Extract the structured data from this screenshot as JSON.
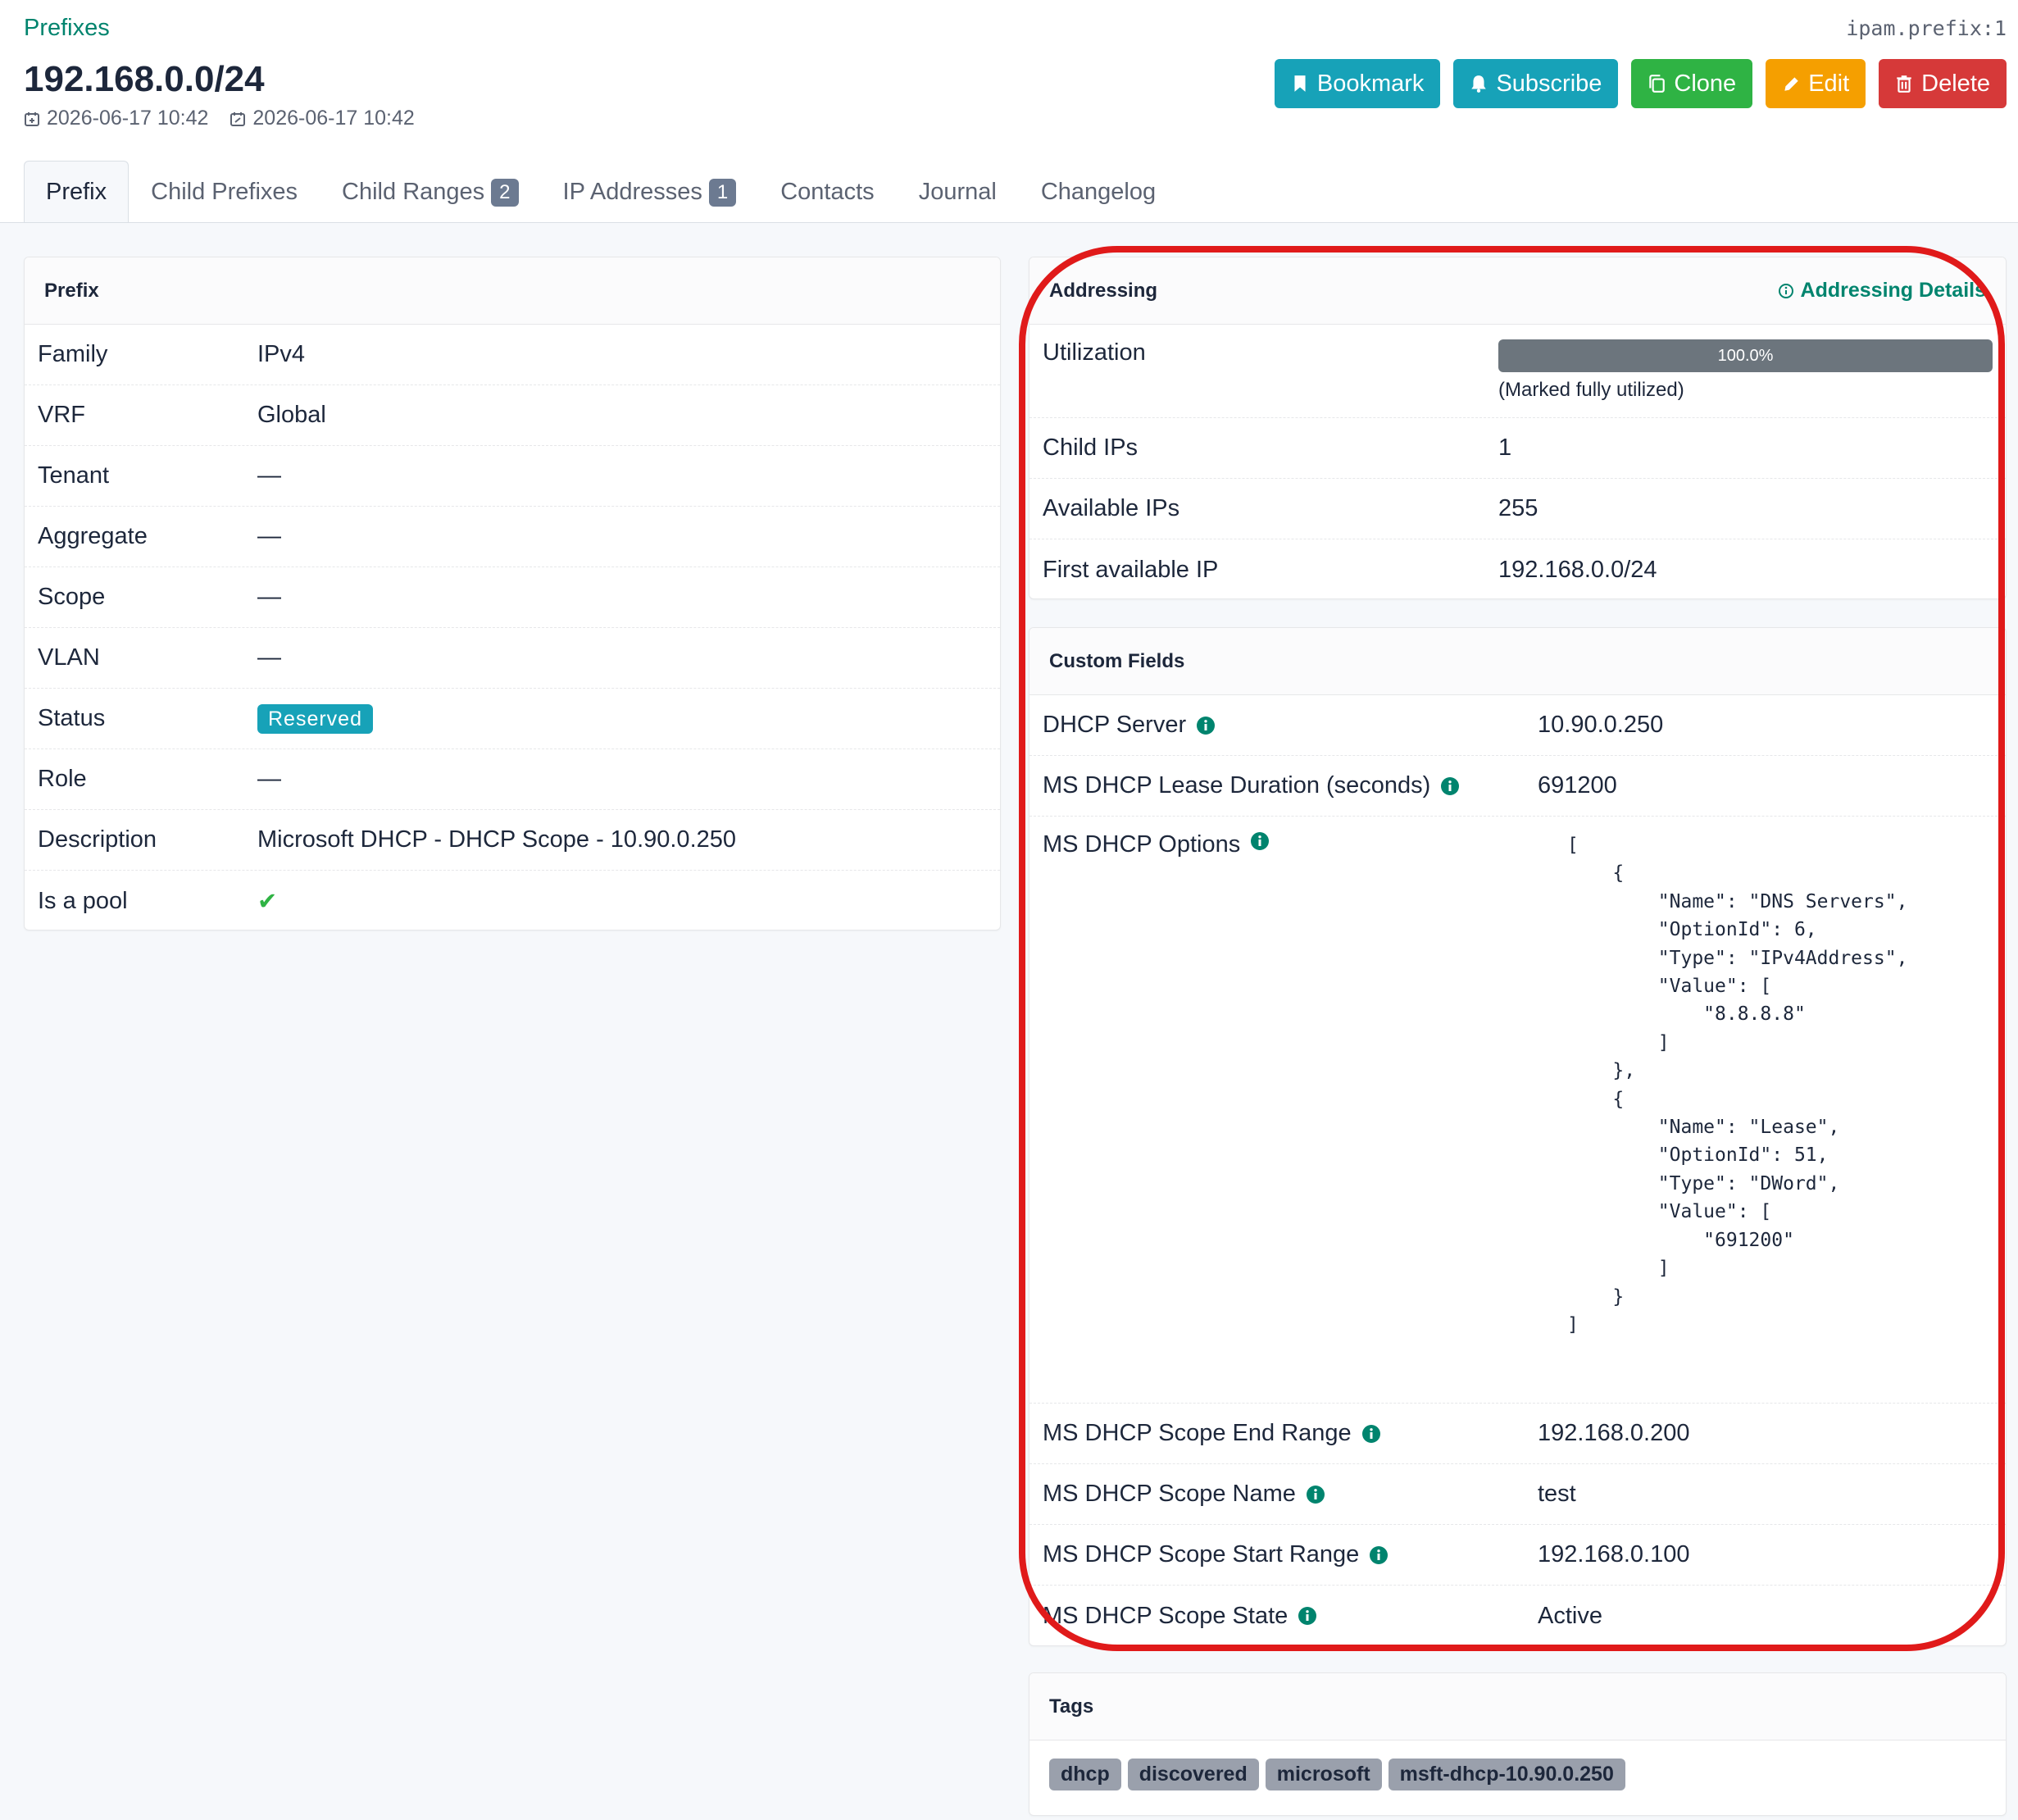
{
  "header": {
    "breadcrumb": "Prefixes",
    "object_id": "ipam.prefix:1",
    "title": "192.168.0.0/24",
    "created": "2026-06-17 10:42",
    "updated": "2026-06-17 10:42",
    "actions": {
      "bookmark": "Bookmark",
      "subscribe": "Subscribe",
      "clone": "Clone",
      "edit": "Edit",
      "delete": "Delete"
    }
  },
  "tabs": [
    {
      "label": "Prefix",
      "active": true
    },
    {
      "label": "Child Prefixes"
    },
    {
      "label": "Child Ranges",
      "badge": "2"
    },
    {
      "label": "IP Addresses",
      "badge": "1"
    },
    {
      "label": "Contacts"
    },
    {
      "label": "Journal"
    },
    {
      "label": "Changelog"
    }
  ],
  "prefix_card": {
    "title": "Prefix",
    "rows": [
      {
        "key": "Family",
        "value": "IPv4"
      },
      {
        "key": "VRF",
        "value": "Global"
      },
      {
        "key": "Tenant",
        "value": "—"
      },
      {
        "key": "Aggregate",
        "value": "—"
      },
      {
        "key": "Scope",
        "value": "—"
      },
      {
        "key": "VLAN",
        "value": "—"
      },
      {
        "key": "Status",
        "value": "Reserved"
      },
      {
        "key": "Role",
        "value": "—"
      },
      {
        "key": "Description",
        "value": "Microsoft DHCP - DHCP Scope - 10.90.0.250"
      },
      {
        "key": "Is a pool",
        "value": "✔"
      }
    ]
  },
  "addressing": {
    "title": "Addressing",
    "details_link": "Addressing Details",
    "utilization_label": "Utilization",
    "utilization_percent": 100,
    "utilization_text": "100.0%",
    "utilization_note": "(Marked fully utilized)",
    "child_ips_label": "Child IPs",
    "child_ips": "1",
    "available_ips_label": "Available IPs",
    "available_ips": "255",
    "first_available_label": "First available IP",
    "first_available": "192.168.0.0/24"
  },
  "custom_fields": {
    "title": "Custom Fields",
    "dhcp_server_label": "DHCP Server",
    "dhcp_server": "10.90.0.250",
    "lease_label": "MS DHCP Lease Duration (seconds)",
    "lease": "691200",
    "options_label": "MS DHCP Options",
    "options_json": "[\n    {\n        \"Name\": \"DNS Servers\",\n        \"OptionId\": 6,\n        \"Type\": \"IPv4Address\",\n        \"Value\": [\n            \"8.8.8.8\"\n        ]\n    },\n    {\n        \"Name\": \"Lease\",\n        \"OptionId\": 51,\n        \"Type\": \"DWord\",\n        \"Value\": [\n            \"691200\"\n        ]\n    }\n]",
    "end_range_label": "MS DHCP Scope End Range",
    "end_range": "192.168.0.200",
    "scope_name_label": "MS DHCP Scope Name",
    "scope_name": "test",
    "start_range_label": "MS DHCP Scope Start Range",
    "start_range": "192.168.0.100",
    "scope_state_label": "MS DHCP Scope State",
    "scope_state": "Active"
  },
  "tags_card": {
    "title": "Tags",
    "tags": [
      "dhcp",
      "discovered",
      "microsoft",
      "msft-dhcp-10.90.0.250"
    ]
  },
  "colors": {
    "accent": "#00846e",
    "info": "#17a2b8",
    "success": "#2fb344",
    "warning": "#f59f00",
    "danger": "#d63939",
    "annotation": "#e01a1a"
  },
  "icons": {
    "bookmark": "bookmark-icon",
    "subscribe": "bell-icon",
    "clone": "copy-icon",
    "edit": "pencil-icon",
    "delete": "trash-icon",
    "created": "calendar-plus-icon",
    "updated": "calendar-edit-icon",
    "info": "info-icon"
  }
}
